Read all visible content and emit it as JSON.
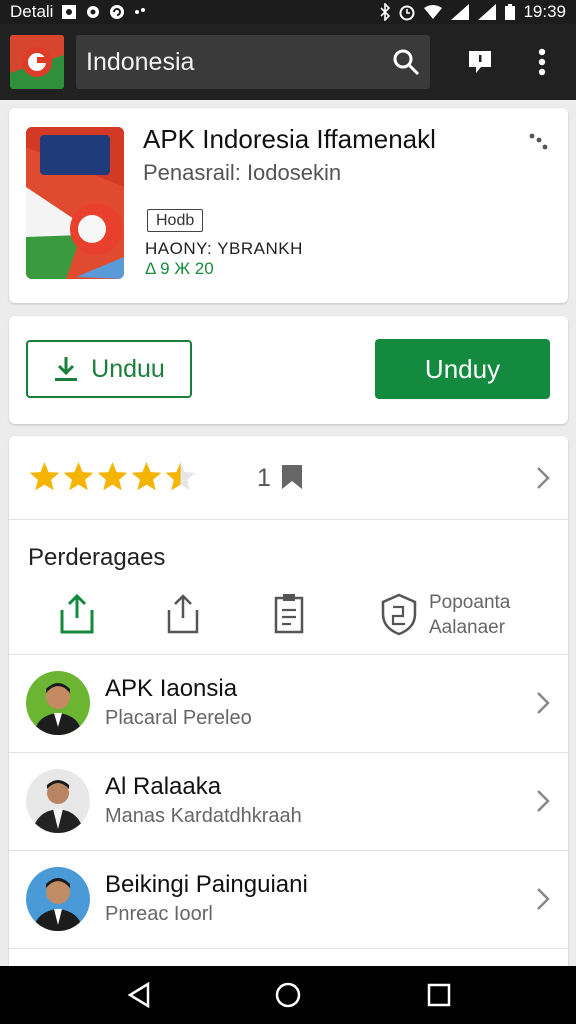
{
  "status_bar": {
    "carrier": "Detali",
    "time": "19:39",
    "left_icons": [
      "gallery-icon",
      "settings-icon",
      "sync-icon",
      "dots-icon"
    ],
    "right_icons": [
      "bluetooth-icon",
      "alarm-icon",
      "wifi-icon",
      "signal-icon",
      "battery-icon"
    ]
  },
  "top_bar": {
    "search_text": "Indonesia",
    "icons": [
      "app-logo-icon",
      "search-icon",
      "feedback-icon",
      "more-vertical-icon"
    ]
  },
  "app_card": {
    "title": "APK Indoresia Iffamenakl",
    "subtitle": "Penasrail: Iodosekin",
    "badge": "Hodb",
    "meta": "HAONY: YBRANKH",
    "downloads": "Δ 9 Ж 20"
  },
  "actions": {
    "outline_label": "Unduu",
    "fill_label": "Unduy"
  },
  "rating": {
    "stars": 4.5,
    "count": "1"
  },
  "permissions": {
    "title": "Perderagaes",
    "line1": "Popoanta",
    "line2": "Aalanaer",
    "icons": [
      "upload-icon",
      "share-icon",
      "clipboard-icon",
      "shield-icon"
    ]
  },
  "developers": [
    {
      "name": "APK Iaonsia",
      "sub": "Placaral Pereleo"
    },
    {
      "name": "Al Ralaaka",
      "sub": "Manas Kardatdhkraah"
    },
    {
      "name": "Beikingi Painguiani",
      "sub": "Pnreac Ioorl"
    }
  ],
  "colors": {
    "accent_green": "#138a3e",
    "star_yellow": "#f4b400",
    "top_bar": "#212121"
  },
  "nav_icons": [
    "back-icon",
    "home-icon",
    "recents-icon"
  ]
}
